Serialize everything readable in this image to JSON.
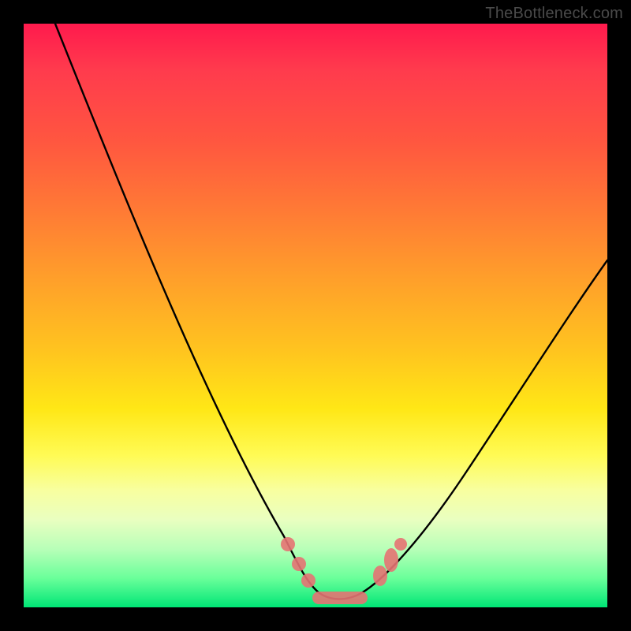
{
  "watermark": "TheBottleneck.com",
  "chart_data": {
    "type": "line",
    "title": "",
    "xlabel": "",
    "ylabel": "",
    "ylim": [
      0,
      100
    ],
    "x": [
      0,
      5,
      10,
      15,
      20,
      25,
      30,
      35,
      40,
      45,
      48,
      50,
      52,
      55,
      58,
      62,
      68,
      75,
      82,
      90,
      100
    ],
    "values": [
      100,
      92,
      83,
      74,
      65,
      56,
      47,
      38,
      29,
      17,
      8,
      3,
      0,
      0,
      0,
      3,
      10,
      20,
      30,
      42,
      58
    ],
    "gradient_meaning": "red-high-bottleneck green-low-bottleneck",
    "markers": {
      "left_cluster_x": [
        45,
        47,
        49
      ],
      "left_cluster_y": [
        8,
        5,
        2
      ],
      "flat_bottom_x_range": [
        50,
        58
      ],
      "right_cluster_x": [
        61,
        63
      ],
      "right_cluster_y": [
        4,
        7
      ]
    }
  }
}
